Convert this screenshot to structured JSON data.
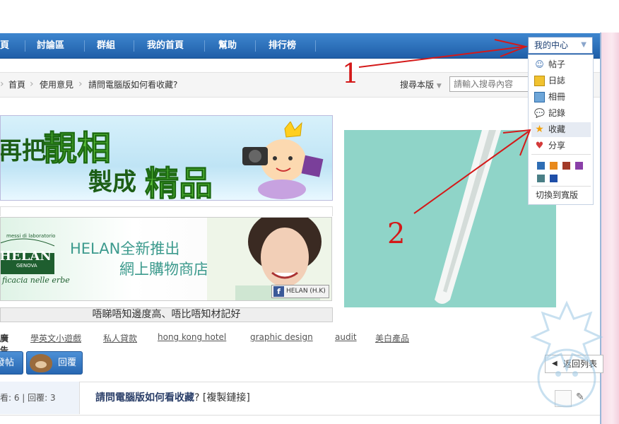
{
  "nav": {
    "items": [
      "頁",
      "討論區",
      "群組",
      "我的首頁",
      "幫助",
      "排行榜"
    ],
    "my_center": "我的中心"
  },
  "breadcrumb": [
    "首頁",
    "使用意見",
    "請問電腦版如何看收藏?"
  ],
  "search": {
    "scope": "搜尋本版",
    "placeholder": "請輸入搜尋內容"
  },
  "dropdown": {
    "items": [
      {
        "label": "帖子",
        "icon": "search-people-icon"
      },
      {
        "label": "日誌",
        "icon": "journal-icon"
      },
      {
        "label": "相冊",
        "icon": "photo-album-icon"
      },
      {
        "label": "記錄",
        "icon": "speech-bubble-icon"
      },
      {
        "label": "收藏",
        "icon": "star-icon"
      },
      {
        "label": "分享",
        "icon": "heart-icon"
      }
    ],
    "swatches": [
      "#2e6db4",
      "#e8891b",
      "#a23a28",
      "#8a3fa8",
      "#4a7f86",
      "#1f4fa8"
    ],
    "switch_label": "切換到寬版"
  },
  "annotations": {
    "one": "1",
    "two": "2"
  },
  "banner1": {
    "t1": "再把",
    "t2": "靚相",
    "t3": "製成",
    "t4": "精品"
  },
  "banner2": {
    "line1": "HELAN全新推出",
    "line2": "網上購物商店",
    "logo_top": "messi di laboratorio",
    "logo_main": "HELAN",
    "logo_sub": "GENOVA",
    "logo_tag": "ficacia nelle erbe",
    "fb_label": "HELAN (H.K)"
  },
  "caption": "唔睇唔知邊度高、唔比唔知材記好",
  "ads": {
    "label": "廣告",
    "links": [
      "學英文小遊戲",
      "私人貸款",
      "hong kong hotel",
      "graphic design",
      "audit",
      "美白產品"
    ]
  },
  "buttons": {
    "post": "發帖",
    "reply": "回覆",
    "back_list": "返回列表"
  },
  "thread": {
    "stats": "看: 6 | 回覆: 3",
    "title": "請問電腦版如何看收藏",
    "title_suffix": "? [複製鏈接]"
  },
  "colors": {
    "nav_blue": "#2b6fbc",
    "red_annotation": "#d41919",
    "teal": "#8fd4c8"
  }
}
